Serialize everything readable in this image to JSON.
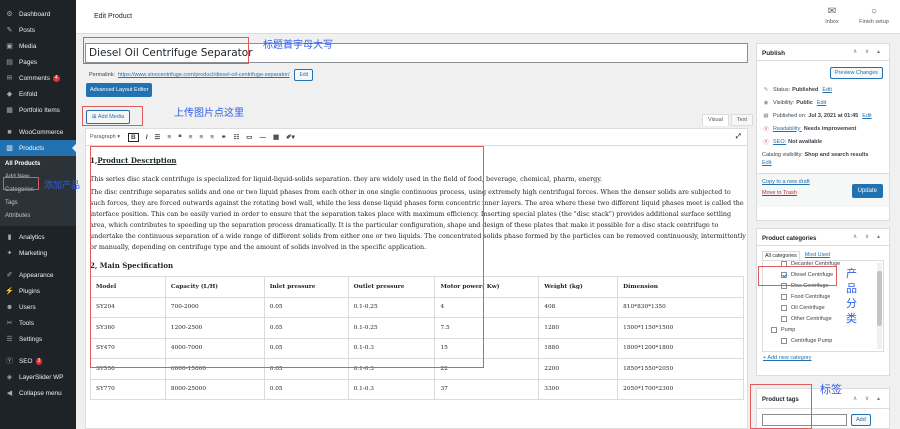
{
  "sidebar": {
    "items": [
      {
        "icon": "dashboard-icon",
        "glyph": "⚙",
        "label": "Dashboard"
      },
      {
        "icon": "pin-icon",
        "glyph": "✎",
        "label": "Posts"
      },
      {
        "icon": "media-icon",
        "glyph": "▣",
        "label": "Media"
      },
      {
        "icon": "pages-icon",
        "glyph": "▤",
        "label": "Pages"
      },
      {
        "icon": "comments-icon",
        "glyph": "✉",
        "label": "Comments",
        "badge": "4"
      },
      {
        "icon": "enfold-icon",
        "glyph": "◆",
        "label": "Enfold"
      },
      {
        "icon": "portfolio-icon",
        "glyph": "▦",
        "label": "Portfolio Items"
      }
    ],
    "woocommerce": {
      "icon": "woo-icon",
      "glyph": "■",
      "label": "WooCommerce"
    },
    "products": {
      "icon": "products-icon",
      "glyph": "▥",
      "label": "Products"
    },
    "submenu": [
      "All Products",
      "Add New",
      "Categories",
      "Tags",
      "Attributes"
    ],
    "items2": [
      {
        "icon": "analytics-icon",
        "glyph": "▮",
        "label": "Analytics"
      },
      {
        "icon": "marketing-icon",
        "glyph": "✦",
        "label": "Marketing"
      }
    ],
    "items3": [
      {
        "icon": "appearance-icon",
        "glyph": "✐",
        "label": "Appearance"
      },
      {
        "icon": "plugins-icon",
        "glyph": "⚡",
        "label": "Plugins"
      },
      {
        "icon": "users-icon",
        "glyph": "☻",
        "label": "Users"
      },
      {
        "icon": "tools-icon",
        "glyph": "✂",
        "label": "Tools"
      },
      {
        "icon": "settings-icon",
        "glyph": "☰",
        "label": "Settings"
      }
    ],
    "items4": [
      {
        "icon": "seo-icon",
        "glyph": "Ⓨ",
        "label": "SEO",
        "badge": "3"
      },
      {
        "icon": "layerslider-icon",
        "glyph": "◈",
        "label": "LayerSlider WP"
      },
      {
        "icon": "collapse-icon",
        "glyph": "◀",
        "label": "Collapse menu"
      }
    ]
  },
  "topbar": {
    "title": "Edit Product",
    "inbox": "Inbox",
    "finish": "Finish setup"
  },
  "post": {
    "title": "Diesel Oil Centrifuge Separator",
    "permalink_label": "Permalink:",
    "permalink_url": "https://www.sinocentrifuge.com/product/diesel-oil-centrifuge-separator/",
    "permalink_edit": "Edit",
    "layout_editor": "Advanced Layout Editor",
    "add_media": "Add Media",
    "tab_visual": "Visual",
    "tab_text": "Text",
    "paragraph": "Paragraph ▾"
  },
  "content": {
    "h1_num": "1,",
    "h1_title": "Product Description",
    "p1": "This series disc stack centrifuge is specialized for liquid-liquid-solids separation. they are widely used in the field of food, beverage, chemical, pharm, energy.",
    "p2": "The disc centrifuge separates solids and one or two liquid phases from each other in one single continuous process, using extremely high centrifugal forces. When the denser solids are subjected to such forces, they are forced outwards against the rotating bowl wall, while the less dense liquid phases form concentric inner layers. The area where these two different liquid phases meet is called the interface position. This can be easily varied in order to ensure that the separation takes place with maximum efficiency. Inserting special plates (the \"disc stack\") provides additional surface settling area, which contributes to speeding up the separation process dramatically. It is the particular configuration, shape and design of these plates that make it possible for a disc stack centrifuge to undertake the continuous separation of a wide range of different solids from either one or two liquids. The concentrated solids phase formed by the particles can be removed continuously, intermittently or manually, depending on centrifuge type and the amount of solids involved in the specific application.",
    "h2": "2, Main Specification",
    "table": {
      "headers": [
        "Model",
        "Capacity (L/H)",
        "Inlet pressure",
        "Outlet pressure",
        "Motor power( Kw)",
        "Weight (kg)",
        "Dimension"
      ],
      "rows": [
        [
          "SY204",
          "700-2000",
          "0.05",
          "0.1-0.25",
          "4",
          "408",
          "810*830*1350"
        ],
        [
          "SY360",
          "1200-2500",
          "0.05",
          "0.1-0.25",
          "7.5",
          "1280",
          "1500*1150*1500"
        ],
        [
          "SY470",
          "4000-7000",
          "0.05",
          "0.1-0.3",
          "15",
          "1880",
          "1800*1200*1800"
        ],
        [
          "SY550",
          "6000-15000",
          "0.05",
          "0.1-0.3",
          "22",
          "2200",
          "1850*1550*2050"
        ],
        [
          "SY770",
          "8000-25000",
          "0.05",
          "0.1-0.3",
          "37",
          "3300",
          "2050*1700*2300"
        ]
      ]
    }
  },
  "publish": {
    "title": "Publish",
    "preview": "Preview Changes",
    "status_label": "Status:",
    "status_value": "Published",
    "visibility_label": "Visibility:",
    "visibility_value": "Public",
    "published_on": "Published on:",
    "published_date": "Jul 3, 2021 at 01:45",
    "readability": "Readability:",
    "readability_value": "Needs improvement",
    "seo": "SEO:",
    "seo_value": "Not available",
    "catalog_label": "Catalog visibility:",
    "catalog_value": "Shop and search results",
    "edit": "Edit",
    "copy_draft": "Copy to a new draft",
    "trash": "Move to Trash",
    "update": "Update"
  },
  "categories": {
    "title": "Product categories",
    "tab_all": "All categories",
    "tab_most": "Most Used",
    "items": [
      {
        "label": "Decanter Centrifuge",
        "checked": false,
        "indent": true
      },
      {
        "label": "Diesel Centrifuge",
        "checked": true,
        "indent": true
      },
      {
        "label": "Disc Centrifuge",
        "checked": false,
        "indent": true
      },
      {
        "label": "Food Centrifuge",
        "checked": false,
        "indent": true
      },
      {
        "label": "Oil Centrifuge",
        "checked": false,
        "indent": true
      },
      {
        "label": "Other Centrifuge",
        "checked": false,
        "indent": true
      },
      {
        "label": "Pump",
        "checked": false,
        "indent": false
      },
      {
        "label": "Centrifuge Pump",
        "checked": false,
        "indent": true
      }
    ],
    "add_new": "+ Add new category"
  },
  "tags": {
    "title": "Product tags",
    "add": "Add"
  },
  "annotations": {
    "title_caps": "标题首字母大写",
    "upload_image": "上传图片点这里",
    "add_product": "添加产品",
    "product_category": "产品分类",
    "tags": "标签"
  }
}
